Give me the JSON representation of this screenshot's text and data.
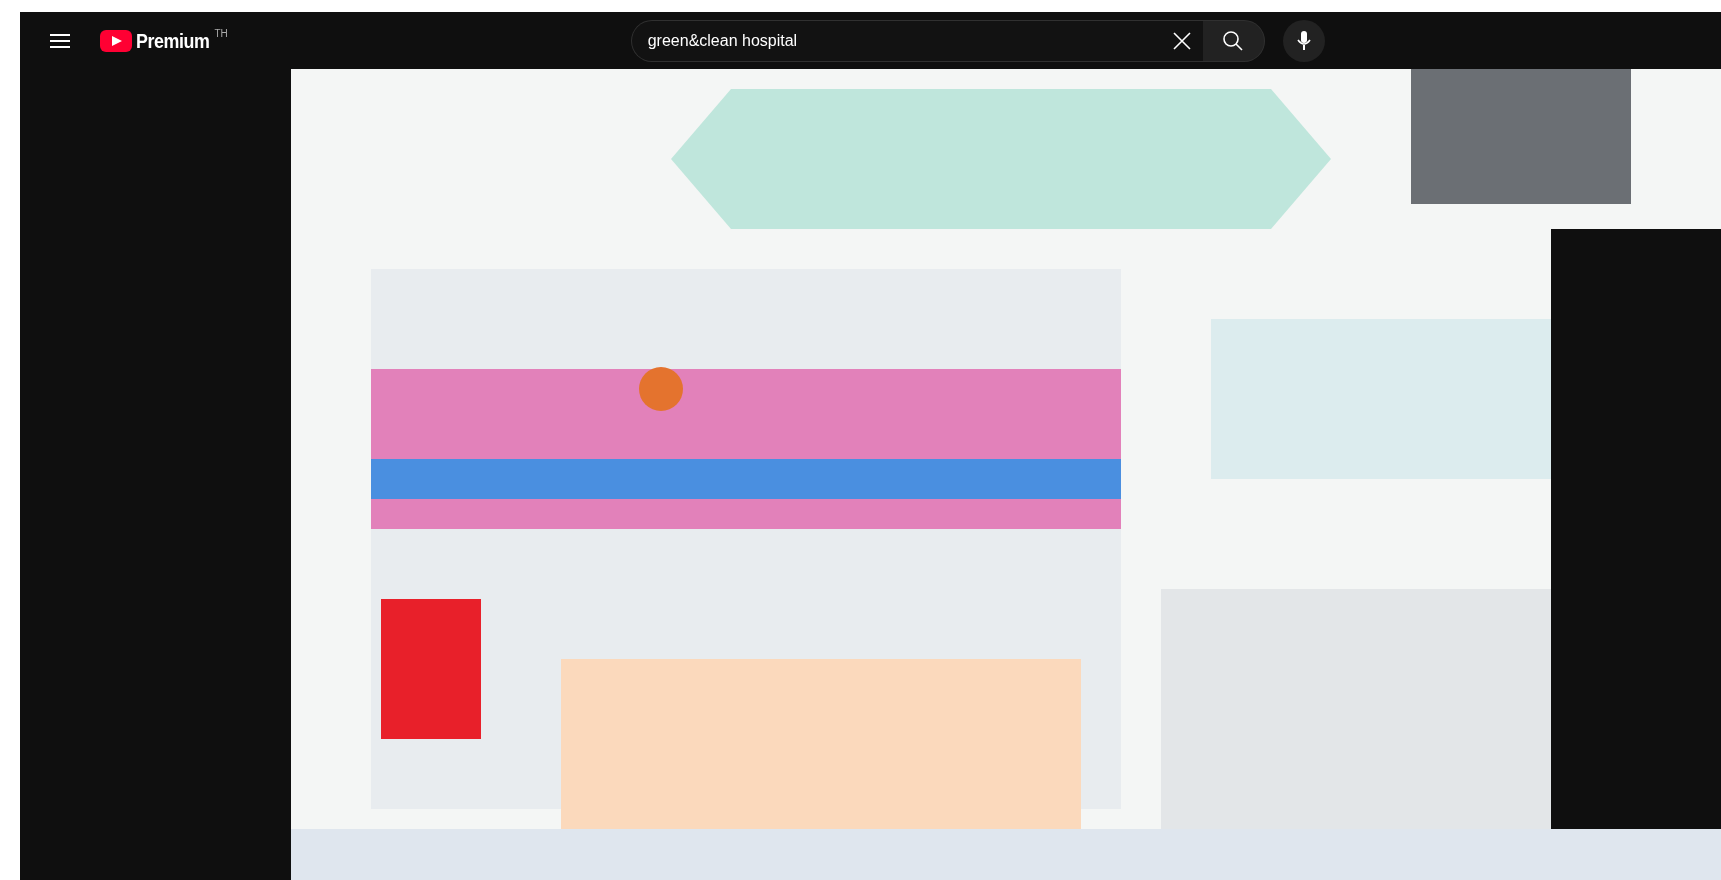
{
  "header": {
    "logo_text": "Premium",
    "region": "TH",
    "search": {
      "value": "green&clean hospital"
    }
  }
}
